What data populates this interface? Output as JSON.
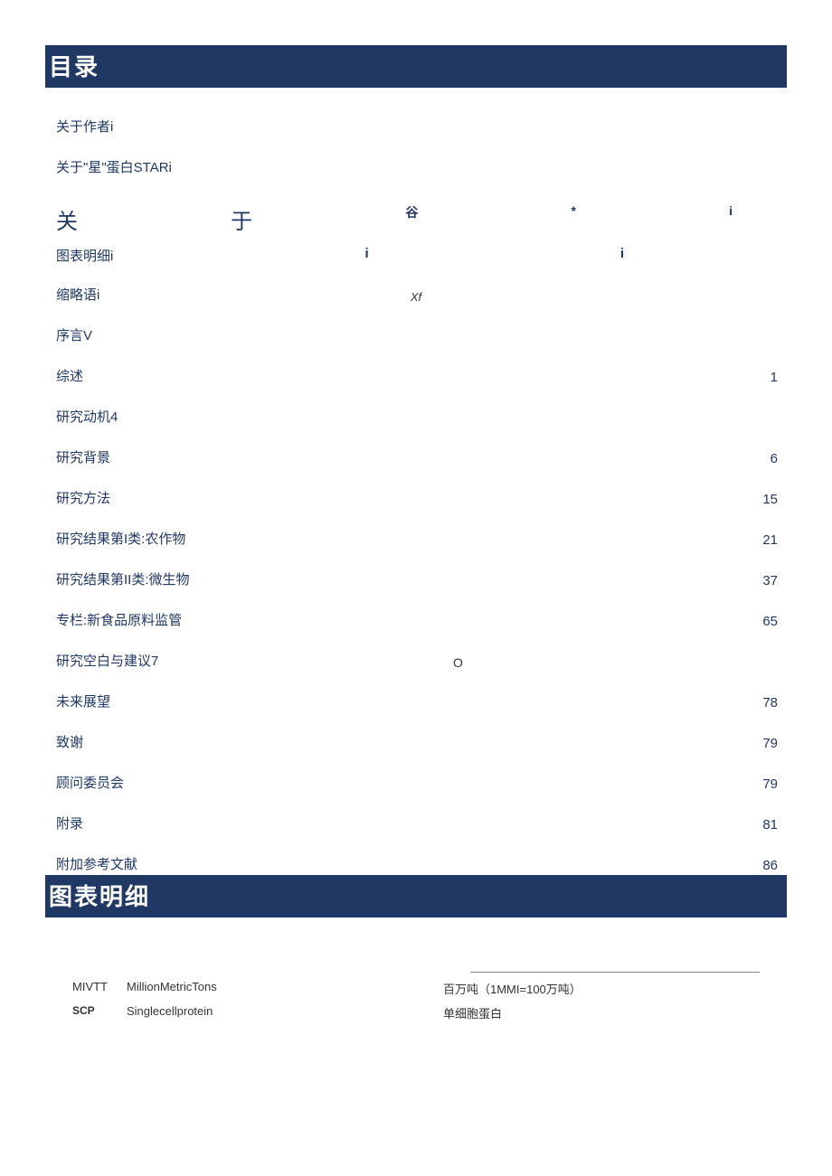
{
  "sections": {
    "toc_title": "目录",
    "figures_title": "图表明细"
  },
  "toc": {
    "item_author": "关于作者i",
    "item_star": "关于\"星\"蛋白STARi",
    "special_big_1": "关",
    "special_big_2": "于",
    "special_sm_1": "谷",
    "special_sm_2": "*",
    "special_sm_3": "i",
    "sub_item_fig": "图表明细i",
    "sub_marker_i1": "i",
    "sub_marker_i2": "i",
    "item_abbr": "缩略语i",
    "xf_marker": "Xf",
    "item_preface": "序言V",
    "item_overview": "综述",
    "page_overview": "1",
    "item_motivation": "研究动机4",
    "item_background": "研究背景",
    "page_background": "6",
    "item_methods": "研究方法",
    "page_methods": "15",
    "item_results1": "研究结果第I类:农作物",
    "page_results1": "21",
    "item_results2": "研究结果第II类:微生物",
    "page_results2": "37",
    "item_column": "专栏:新食品原料监管",
    "page_column": "65",
    "item_gaps": "研究空白与建议7",
    "o_marker": "O",
    "item_outlook": "未来展望",
    "page_outlook": "78",
    "item_thanks": "致谢",
    "page_thanks": "79",
    "item_board": "顾问委员会",
    "page_board": "79",
    "item_appendix": "附录",
    "page_appendix": "81",
    "item_refs": "附加参考文献",
    "page_refs": "86"
  },
  "terms": {
    "row1_abbr": "MIVTT",
    "row1_en": "MillionMetricTons",
    "row1_zh": "百万吨（1MMI=100万吨）",
    "row2_abbr": "SCP",
    "row2_en": "Singlecellprotein",
    "row2_zh": "单细胞蛋白"
  }
}
